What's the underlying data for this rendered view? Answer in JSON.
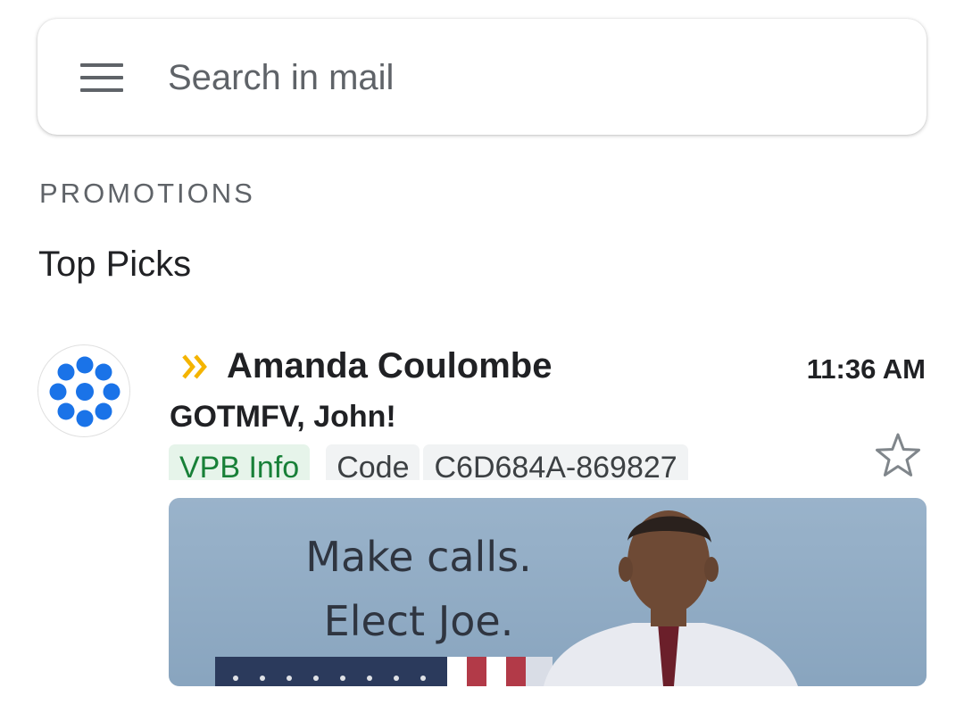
{
  "search": {
    "placeholder": "Search in mail"
  },
  "section": {
    "label": "PROMOTIONS"
  },
  "group": {
    "title": "Top Picks"
  },
  "email": {
    "sender": "Amanda Coulombe",
    "time": "11:36 AM",
    "subject": "GOTMFV, John!",
    "chips": [
      {
        "label": "VPB Info"
      },
      {
        "label": "Code"
      },
      {
        "label": "C6D684A-869827"
      }
    ],
    "image": {
      "line1": "Make calls.",
      "line2": "Elect Joe."
    }
  },
  "icons": {
    "menu": "menu-icon",
    "importance": "importance-marker-icon",
    "star": "star-outline-icon",
    "avatar": "dots-logo-icon"
  },
  "colors": {
    "importance": "#f4b400",
    "avatar_dots": "#1a73e8",
    "chip_green_bg": "#e6f4ea",
    "chip_green_text": "#188038",
    "chip_gray_bg": "#f1f3f4"
  }
}
